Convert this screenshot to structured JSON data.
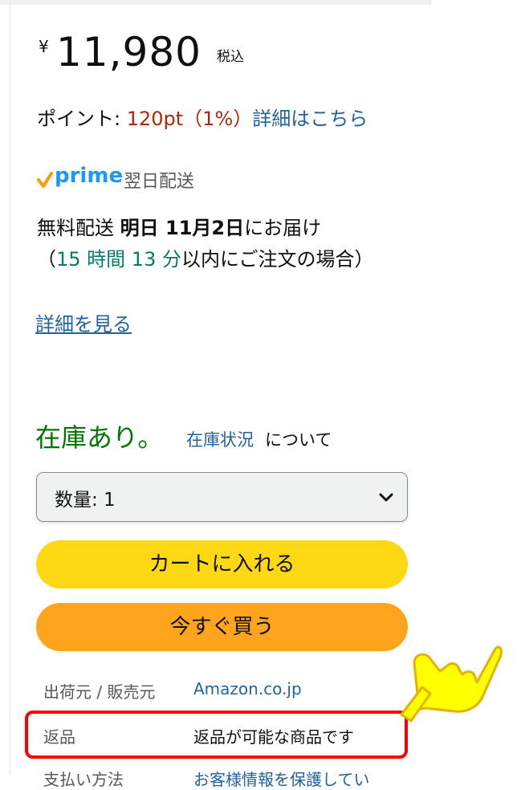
{
  "price": {
    "currency": "¥",
    "amount": "11,980",
    "tax": "税込"
  },
  "points": {
    "label": "ポイント: ",
    "value": "120pt（1%）",
    "link": "詳細はこちら"
  },
  "prime": {
    "logo_text": "prime",
    "label": "翌日配送"
  },
  "delivery": {
    "prefix": "無料配送 ",
    "date": "明日 11月2日",
    "suffix": "にお届け",
    "paren_open": "（",
    "hours": "15 時間 13 分",
    "cutoff": "以内にご注文の場合）",
    "details_link": "詳細を見る"
  },
  "stock": {
    "status": "在庫あり。",
    "link": "在庫状況",
    "suffix": "について"
  },
  "quantity": {
    "label": "数量: 1"
  },
  "buttons": {
    "cart": "カートに入れる",
    "buy": "今すぐ買う"
  },
  "info_rows": [
    {
      "key": "出荷元 / 販売元",
      "value": "Amazon.co.jp"
    },
    {
      "key": "返品",
      "value": "返品が可能な商品です"
    },
    {
      "key": "支払い方法",
      "value": "お客様情報を保護してい"
    }
  ],
  "colors": {
    "price_red": "#b12704",
    "link_blue": "#2162a1",
    "in_stock_green": "#007600",
    "cart_yellow": "#ffd814",
    "buy_orange": "#ffa41c",
    "annotation_red": "#ff0000",
    "annotation_hand": "#ffff00"
  },
  "icons": {
    "prime_check": "check-icon",
    "dropdown": "chevron-down-icon",
    "annotation": "pointing-hand-icon"
  }
}
